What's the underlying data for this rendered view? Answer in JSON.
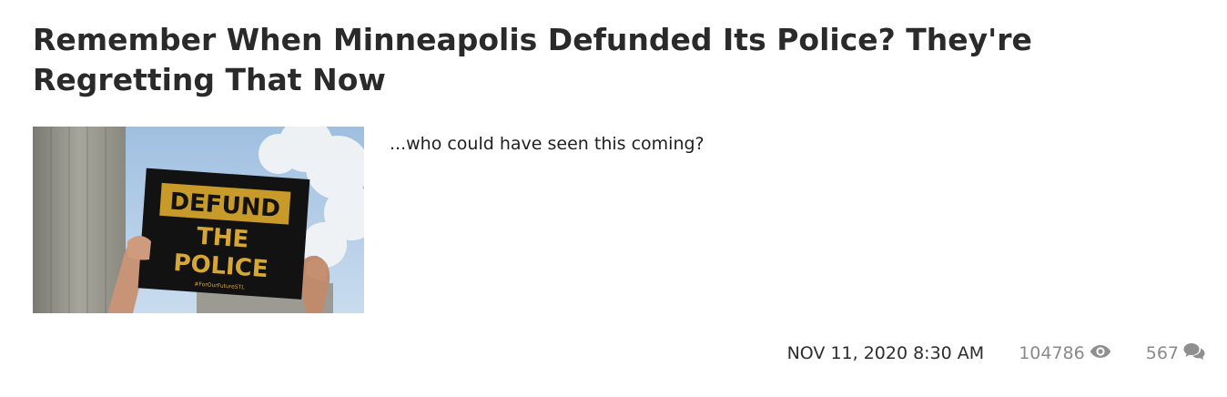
{
  "article": {
    "title": "Remember When Minneapolis Defunded Its Police? They're Regretting That Now",
    "excerpt": "...who could have seen this coming?",
    "image": {
      "sign_line1": "DEFUND",
      "sign_line2": "THE",
      "sign_line3": "POLICE",
      "sign_hashtag": "#ForOurFutureSTL"
    },
    "date": "NOV 11, 2020 8:30 AM",
    "views": "104786",
    "comments": "567",
    "icons": {
      "views": "eye-icon",
      "comments": "comments-icon"
    }
  }
}
